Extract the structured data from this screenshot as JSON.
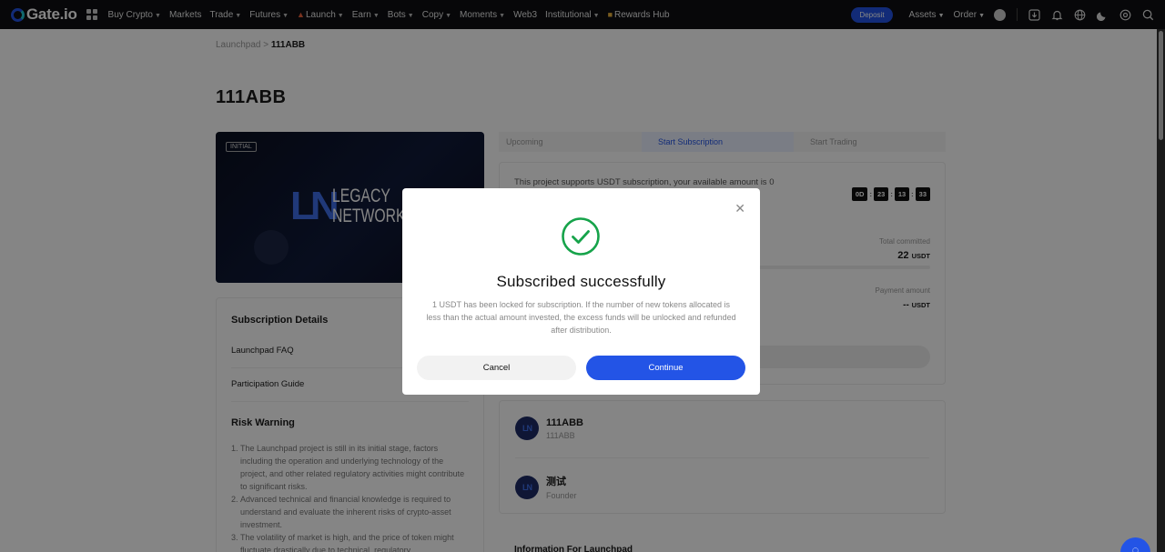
{
  "header": {
    "brand": "Gate.io",
    "nav": [
      {
        "label": "Buy Crypto",
        "caret": true
      },
      {
        "label": "Markets",
        "caret": false
      },
      {
        "label": "Trade",
        "caret": true
      },
      {
        "label": "Futures",
        "caret": true
      },
      {
        "label": "Launch",
        "caret": true
      },
      {
        "label": "Earn",
        "caret": true
      },
      {
        "label": "Bots",
        "caret": true
      },
      {
        "label": "Copy",
        "caret": true
      },
      {
        "label": "Moments",
        "caret": true
      },
      {
        "label": "Web3",
        "caret": false
      },
      {
        "label": "Institutional",
        "caret": true
      },
      {
        "label": "Rewards Hub",
        "caret": false
      }
    ],
    "deposit": "Deposit",
    "assets": "Assets",
    "order": "Order",
    "icons": [
      "download-icon",
      "bell-icon",
      "globe-icon",
      "moon-icon",
      "settings-icon",
      "search-icon"
    ]
  },
  "breadcrumb": {
    "root": "Launchpad",
    "separator": ">",
    "current": "111ABB"
  },
  "project": {
    "title": "111ABB",
    "banner": {
      "badge": "INITIAL",
      "logo_mark": "LN",
      "logo_line1": "LEGACY",
      "logo_line2": "NETWORK"
    }
  },
  "sidebar": {
    "details_title": "Subscription Details",
    "faq": "Launchpad FAQ",
    "guide": "Participation Guide",
    "risk_title": "Risk Warning",
    "risks": [
      {
        "n": "1.",
        "text": "The Launchpad project is still in its initial stage, factors including the operation and underlying technology of the project, and other related regulatory activities might contribute to significant risks."
      },
      {
        "n": "2.",
        "text": "Advanced technical and financial knowledge is required to understand and evaluate the inherent risks of crypto-asset investment."
      },
      {
        "n": "3.",
        "text": "The volatility of market is high, and the price of token might fluctuate drastically due to technical, regulatory"
      }
    ]
  },
  "steps": [
    "Upcoming",
    "Start Subscription",
    "Start Trading"
  ],
  "subscription": {
    "available_text": "This project supports USDT subscription, your available amount is 0",
    "timer": {
      "days": "0D",
      "hours": "23",
      "minutes": "13",
      "seconds": "33"
    },
    "total_label": "Total committed",
    "total_value": "22",
    "total_unit": "USDT",
    "payment_label": "Payment amount",
    "payment_value": "--",
    "payment_unit": "USDT"
  },
  "team": [
    {
      "avatar": "LN",
      "name": "111ABB",
      "role": "111ABB"
    },
    {
      "avatar": "LN",
      "name": "测试",
      "role": "Founder"
    }
  ],
  "info_title": "Information For Launchpad",
  "modal": {
    "title": "Subscribed successfully",
    "body": "1 USDT has been locked for subscription. If the number of new tokens allocated is less than the actual amount invested, the excess funds will be unlocked and refunded after distribution.",
    "cancel": "Cancel",
    "continue": "Continue",
    "accent": "#16a34a"
  },
  "colors": {
    "brand": "#2354e6",
    "success": "#16a34a"
  }
}
